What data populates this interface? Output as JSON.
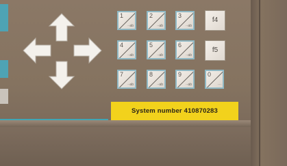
{
  "keypad": {
    "keys": [
      {
        "number": "1",
        "caption": "··ab"
      },
      {
        "number": "2",
        "caption": "··ab"
      },
      {
        "number": "3",
        "caption": "··ab"
      },
      {
        "number": "4",
        "caption": "··ab"
      },
      {
        "number": "5",
        "caption": "··ab"
      },
      {
        "number": "6",
        "caption": "··ab"
      },
      {
        "number": "7",
        "caption": "··ab"
      },
      {
        "number": "8",
        "caption": "··ab"
      },
      {
        "number": "9",
        "caption": "··ab"
      },
      {
        "number": "0",
        "caption": "···"
      }
    ],
    "function_keys": [
      {
        "label": "f4"
      },
      {
        "label": "f5"
      }
    ]
  },
  "system_label": {
    "text": "System number 410870283"
  },
  "colors": {
    "accent_teal": "#3fa6b5",
    "label_yellow": "#f2d21c",
    "panel_brown": "#8a7764"
  }
}
